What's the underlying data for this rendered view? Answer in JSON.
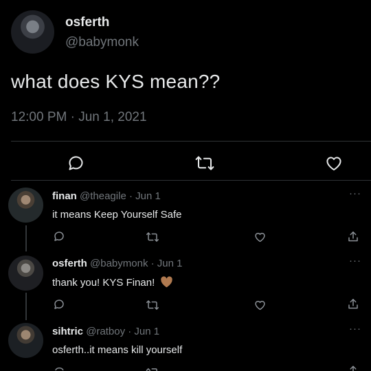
{
  "main_tweet": {
    "display_name": "osferth",
    "handle": "@babymonk",
    "text": "what does KYS mean??",
    "timestamp": "12:00 PM · Jun 1, 2021"
  },
  "icons": {
    "reply": "reply-icon",
    "retweet": "retweet-icon",
    "like": "heart-icon",
    "share": "share-icon",
    "more": "more-icon"
  },
  "replies": [
    {
      "display_name": "finan",
      "meta": "@theagile · Jun 1",
      "text": "it means Keep Yourself Safe",
      "more": "···"
    },
    {
      "display_name": "osferth",
      "meta": "@babymonk · Jun 1",
      "text": "thank you! KYS Finan!",
      "emoji": "brown-heart-emoji",
      "more": "···"
    },
    {
      "display_name": "sihtric",
      "meta": "@ratboy · Jun 1",
      "text": "osferth..it means kill yourself",
      "more": "···"
    }
  ],
  "colors": {
    "background": "#000000",
    "text": "#e7e9ea",
    "muted": "#71767b",
    "divider": "#2f3336",
    "brown_heart": "#b07a50"
  }
}
